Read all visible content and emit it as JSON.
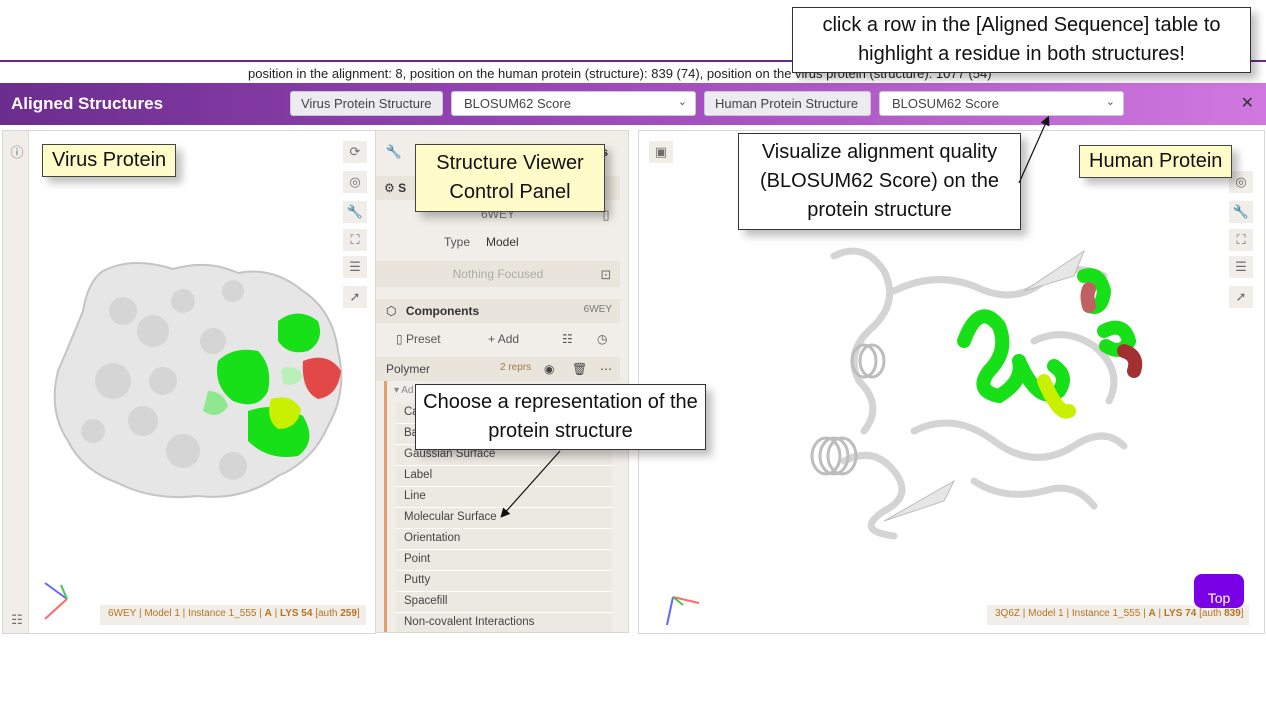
{
  "position_info": "position in the alignment: 8, position on the human protein (structure): 839 (74), position on the virus protein (structure): 1077 (54)",
  "header": {
    "title": "Aligned Structures",
    "virus_button": "Virus Protein Structure",
    "virus_select": "BLOSUM62 Score",
    "human_button": "Human Protein Structure",
    "human_select": "BLOSUM62 Score",
    "close_icon": "close-icon"
  },
  "viewer_left": {
    "status": {
      "entry": "6WEY",
      "model": "Model 1",
      "instance": "Instance 1_555",
      "chain": "A",
      "residue": "LYS 54",
      "auth_label": "[auth",
      "auth_num": "259",
      "auth_end": "]"
    }
  },
  "viewer_right": {
    "status": {
      "entry": "3Q6Z",
      "model": "Model 1",
      "instance": "Instance 1_555",
      "chain": "A",
      "residue": "LYS 74",
      "auth_label": "[auth",
      "auth_num": "839",
      "auth_end": "]"
    },
    "top_button": "Top"
  },
  "control_panel": {
    "truncated_header": "ls",
    "structure_section_s": "S",
    "entry_id": "6WEY",
    "type_label": "Type",
    "type_value": "Model",
    "nothing_focused": "Nothing Focused",
    "components_label": "Components",
    "components_id": "6WEY",
    "preset_label": "Preset",
    "add_label": "Add",
    "polymer_label": "Polymer",
    "polymer_reprs": "2 reprs",
    "add_repr_truncated": "Ad",
    "rep_items": [
      "Ca",
      "Ba",
      "Gaussian Surface",
      "Label",
      "Line",
      "Molecular Surface",
      "Orientation",
      "Point",
      "Putty",
      "Spacefill",
      "Non-covalent Interactions"
    ]
  },
  "annotations": {
    "click_row": "click a row in the [Aligned Sequence] table to highlight a residue in both structures!",
    "visualize": "Visualize alignment quality (BLOSUM62 Score) on the protein structure",
    "choose_rep": "Choose a representation of the protein structure",
    "virus_label": "Virus Protein",
    "control_label": "Structure Viewer Control Panel",
    "human_label": "Human Protein"
  },
  "colors": {
    "header_start": "#6b2d8e",
    "header_end": "#d178e0",
    "match_green": "#18e018",
    "mismatch_red": "#e34848",
    "partial_yellow": "#c8f000",
    "status_text": "#b5731e",
    "top_button": "#7a00e6"
  }
}
